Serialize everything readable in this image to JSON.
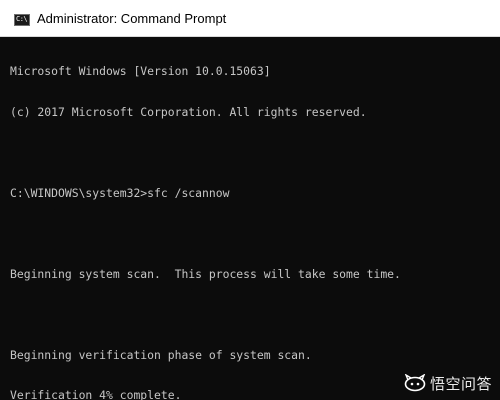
{
  "window": {
    "title": "Administrator: Command Prompt",
    "icon": "command-prompt-icon",
    "icon_glyph": "C:\\"
  },
  "console": {
    "lines": [
      "Microsoft Windows [Version 10.0.15063]",
      "(c) 2017 Microsoft Corporation. All rights reserved.",
      "",
      "C:\\WINDOWS\\system32>sfc /scannow",
      "",
      "Beginning system scan.  This process will take some time.",
      "",
      "Beginning verification phase of system scan.",
      "Verification 4% complete."
    ],
    "text_color": "#c6c6c6",
    "background_color": "#0c0c0c"
  },
  "watermark": {
    "logo": "wukong-logo",
    "text": "悟空问答"
  }
}
